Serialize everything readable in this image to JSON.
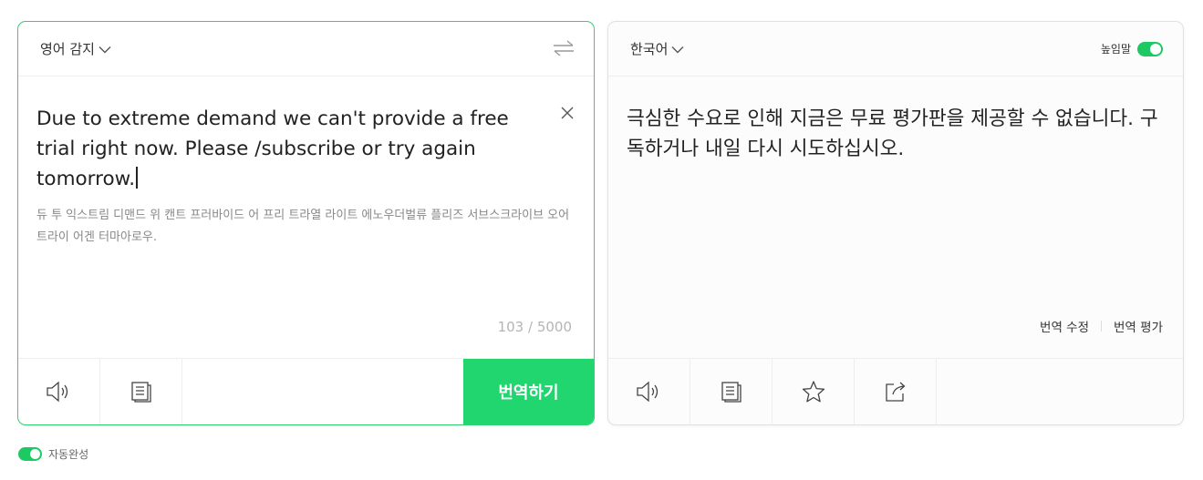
{
  "source": {
    "language_label": "영어 감지",
    "text": "Due to extreme demand we can't provide a free trial right now. Please /subscribe or try again tomorrow.",
    "pronunciation": "듀 투 익스트림 디맨드 위 캔트 프러바이드 어 프리 트라열 라이트 에노우더벌류 플리즈 서브스크라이브 오어 트라이 어겐 터마아로우.",
    "char_count": "103 / 5000",
    "translate_button": "번역하기"
  },
  "target": {
    "language_label": "한국어",
    "honorific_label": "높임말",
    "text": "극심한 수요로 인해 지금은 무료 평가판을 제공할 수 없습니다. 구독하거나 내일 다시 시도하십시오.",
    "edit_translation": "번역 수정",
    "rate_translation": "번역 평가"
  },
  "footer": {
    "autocomplete_label": "자동완성"
  },
  "colors": {
    "accent": "#22d66f",
    "toggle_on": "#1ec964",
    "source_border": "#2fd26e"
  }
}
